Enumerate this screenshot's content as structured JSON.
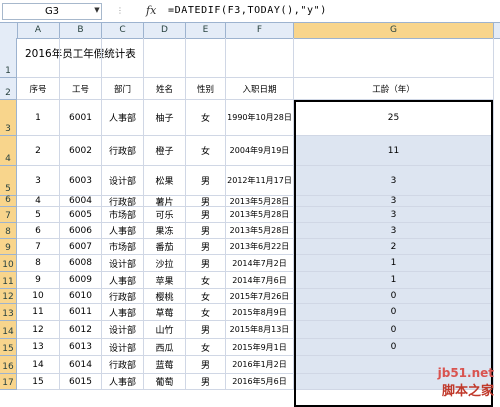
{
  "formula_bar": {
    "name_box": "G3",
    "fx_label": "fx",
    "formula": "=DATEDIF(F3,TODAY(),\"y\")"
  },
  "columns": [
    "A",
    "B",
    "C",
    "D",
    "E",
    "F",
    "G"
  ],
  "row_numbers": [
    "1",
    "2",
    "3",
    "4",
    "5",
    "6",
    "7",
    "8",
    "9",
    "10",
    "11",
    "12",
    "13",
    "14",
    "15",
    "16",
    "17"
  ],
  "title": "2016年员工年假统计表",
  "headers": [
    "序号",
    "工号",
    "部门",
    "姓名",
    "性别",
    "入职日期",
    "工龄（年）"
  ],
  "rows": [
    [
      "1",
      "6001",
      "人事部",
      "柚子",
      "女",
      "1990年10月28日",
      "25"
    ],
    [
      "2",
      "6002",
      "行政部",
      "橙子",
      "女",
      "2004年9月19日",
      "11"
    ],
    [
      "3",
      "6003",
      "设计部",
      "松果",
      "男",
      "2012年11月17日",
      "3"
    ],
    [
      "4",
      "6004",
      "行政部",
      "薯片",
      "男",
      "2013年5月28日",
      "3"
    ],
    [
      "5",
      "6005",
      "市场部",
      "可乐",
      "男",
      "2013年5月28日",
      "3"
    ],
    [
      "6",
      "6006",
      "人事部",
      "果冻",
      "男",
      "2013年5月28日",
      "3"
    ],
    [
      "7",
      "6007",
      "市场部",
      "番茄",
      "男",
      "2013年6月22日",
      "2"
    ],
    [
      "8",
      "6008",
      "设计部",
      "沙拉",
      "男",
      "2014年7月2日",
      "1"
    ],
    [
      "9",
      "6009",
      "人事部",
      "苹果",
      "女",
      "2014年7月6日",
      "1"
    ],
    [
      "10",
      "6010",
      "行政部",
      "樱桃",
      "女",
      "2015年7月26日",
      "0"
    ],
    [
      "11",
      "6011",
      "人事部",
      "草莓",
      "女",
      "2015年8月9日",
      "0"
    ],
    [
      "12",
      "6012",
      "设计部",
      "山竹",
      "男",
      "2015年8月13日",
      "0"
    ],
    [
      "13",
      "6013",
      "设计部",
      "西瓜",
      "女",
      "2015年9月1日",
      "0"
    ],
    [
      "14",
      "6014",
      "行政部",
      "蓝莓",
      "男",
      "2016年1月2日",
      ""
    ],
    [
      "15",
      "6015",
      "人事部",
      "葡萄",
      "男",
      "2016年5月6日",
      ""
    ]
  ],
  "watermark": {
    "line1": "jb51.net",
    "line2": "脚本之家"
  }
}
